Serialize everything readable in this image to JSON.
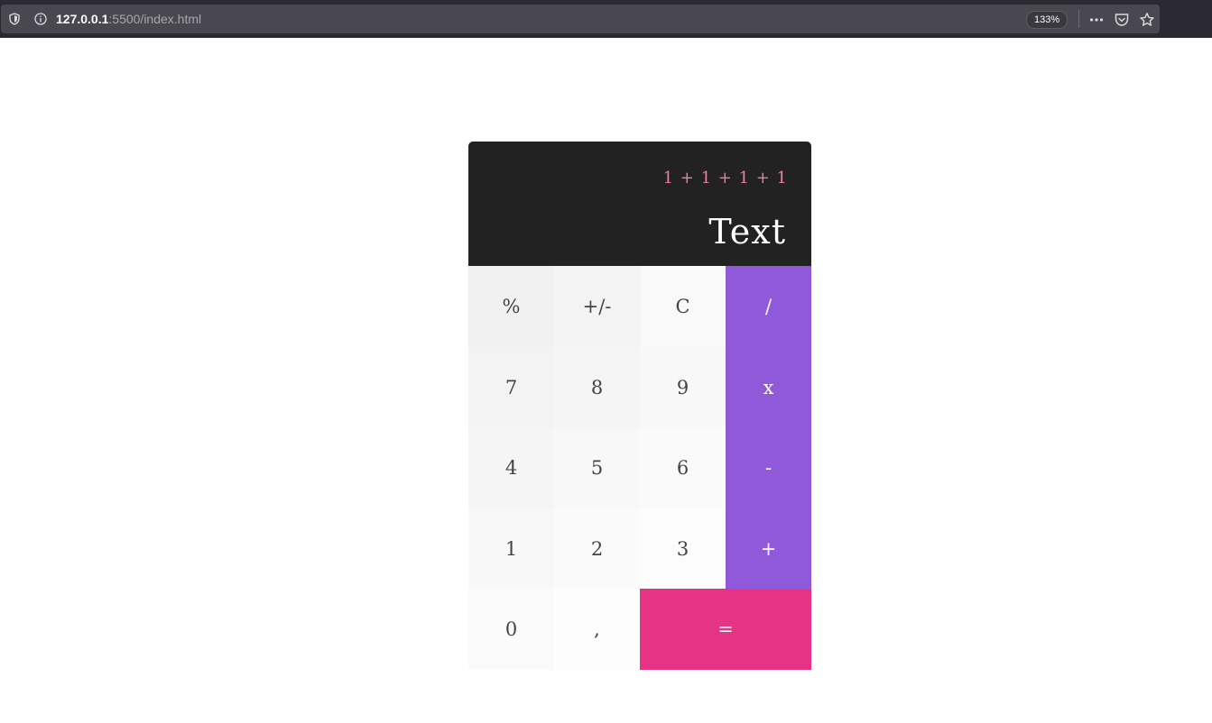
{
  "browser": {
    "url_host": "127.0.0.1",
    "url_rest": ":5500/index.html",
    "zoom": "133%",
    "icons": [
      "shield-icon",
      "info-icon",
      "more-icon",
      "pocket-icon",
      "bookmark-star-icon"
    ]
  },
  "calculator": {
    "expression": "1 + 1 + 1 + 1",
    "result": "Text",
    "keys": {
      "percent": "%",
      "sign": "+/-",
      "clear": "C",
      "divide": "/",
      "seven": "7",
      "eight": "8",
      "nine": "9",
      "multiply": "x",
      "four": "4",
      "five": "5",
      "six": "6",
      "subtract": "-",
      "one": "1",
      "two": "2",
      "three": "3",
      "add": "+",
      "zero": "0",
      "decimal": ",",
      "equals": "="
    },
    "colors": {
      "display_bg": "#222222",
      "expression": "#e8819c",
      "operator_bg": "#8f59da",
      "equals_bg": "#e53385"
    }
  }
}
